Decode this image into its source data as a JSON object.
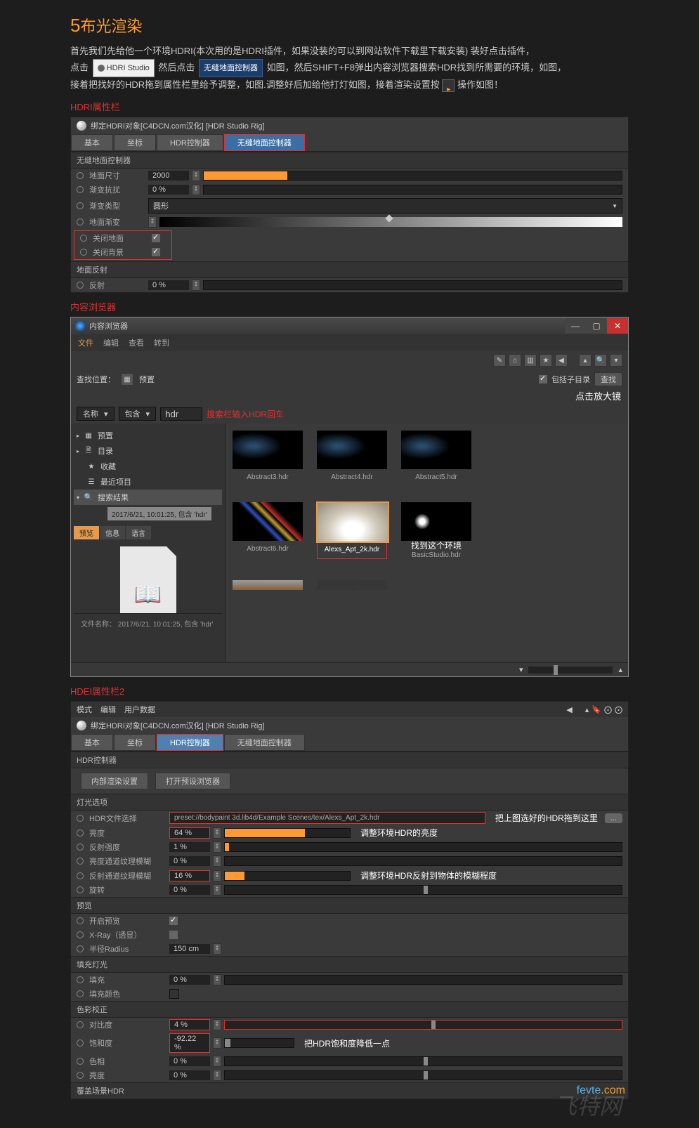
{
  "step": {
    "num": "5",
    "title": "布光渲染"
  },
  "intro": {
    "l1": "首先我们先给他一个环境HDRI(本次用的是HDRI插件，如果没装的可以到网站软件下载里下载安装) 装好点击插件，",
    "l2a": "点击",
    "hdri_btn": "HDRI Studio",
    "l2b": "然后点击",
    "ground_btn": "无缝地面控制器",
    "l2c": "如图，然后SHIFT+F8弹出内容浏览器搜索HDR找到所需要的环境，如图，",
    "l3a": "接着把找好的HDR拖到属性栏里给予调整，如图.调整好后加给他打灯如图，接着渲染设置按",
    "l3b": "操作如图！"
  },
  "sec1": "HDRI属性栏",
  "p1": {
    "head": "绑定HDRI对象[C4DCN.com汉化] [HDR Studio Rig]",
    "tabs": [
      "基本",
      "坐标",
      "HDR控制器",
      "无缝地面控制器"
    ],
    "sub1": "无缝地面控制器",
    "r1": {
      "lbl": "地面尺寸",
      "val": "2000"
    },
    "r2": {
      "lbl": "渐变抗扰",
      "val": "0 %"
    },
    "r3": {
      "lbl": "渐变类型",
      "val": "圆形"
    },
    "r4": {
      "lbl": "地面渐变"
    },
    "r5": {
      "lbl": "关闭地面"
    },
    "r6": {
      "lbl": "关闭背景"
    },
    "sub2": "地面反射",
    "r7": {
      "lbl": "反射",
      "val": "0 %"
    }
  },
  "sec2": "内容浏览器",
  "cb": {
    "title": "内容浏览器",
    "menu": [
      "文件",
      "编辑",
      "查看",
      "转到"
    ],
    "searchloc": "查找位置：",
    "preset": "预置",
    "include": "包括子目录",
    "searchbtn": "查找",
    "magnify": "点击放大镜",
    "name": "名称",
    "contain": "包含",
    "hdr": "hdr",
    "hint": "搜索栏输入HDR回车",
    "tree": [
      "预置",
      "目录",
      "收藏",
      "最近项目",
      "搜索结果"
    ],
    "tree_sub": "2017/6/21, 10:01:25, 包含 'hdr'",
    "ttabs": [
      "预览",
      "信息",
      "语言"
    ],
    "status": "文件名称：  2017/6/21, 10:01:25, 包含 'hdr'",
    "thumbs1": [
      "Abstract3.hdr",
      "Abstract4.hdr",
      "Abstract5.hdr"
    ],
    "thumbs2": [
      "Abstract6.hdr",
      "Alexs_Apt_2k.hdr",
      "BasicStudio.hdr"
    ],
    "found": "找到这个环境"
  },
  "sec3": "HDEI属性栏2",
  "p3": {
    "modes": [
      "模式",
      "编辑",
      "用户数据"
    ],
    "head": "绑定HDRI对象[C4DCN.com汉化] [HDR Studio Rig]",
    "tabs": [
      "基本",
      "坐标",
      "HDR控制器",
      "无缝地面控制器"
    ],
    "sub1": "HDR控制器",
    "btn1": "内部渲染设置",
    "btn2": "打开预设浏览器",
    "sub2": "灯光选项",
    "path_lbl": "HDR文件选择",
    "path": "preset://bodypaint 3d.lib4d/Example Scenes/tex/Alexs_Apt_2k.hdr",
    "ann_path": "把上图选好的HDR拖到这里",
    "bright": {
      "lbl": "亮度",
      "val": "64 %"
    },
    "ann_bright": "调整环境HDR的亮度",
    "refstr": {
      "lbl": "反射强度",
      "val": "1 %"
    },
    "brblur": {
      "lbl": "亮度通道纹理模糊",
      "val": "0 %"
    },
    "refblur": {
      "lbl": "反射通道纹理模糊",
      "val": "16 %"
    },
    "ann_refblur": "调整环境HDR反射到物体的模糊程度",
    "rot": {
      "lbl": "旋转",
      "val": "0 %"
    },
    "sub3": "预览",
    "prev": {
      "lbl": "开启预览"
    },
    "xray": {
      "lbl": "X-Ray（透显）"
    },
    "radius": {
      "lbl": "半径Radius",
      "val": "150 cm"
    },
    "sub4": "填充灯光",
    "fill": {
      "lbl": "填充",
      "val": "0 %"
    },
    "fillc": {
      "lbl": "填充颜色"
    },
    "sub5": "色彩校正",
    "contrast": {
      "lbl": "对比度",
      "val": "4 %"
    },
    "sat": {
      "lbl": "饱和度",
      "val": "-92.22 %"
    },
    "ann_sat": "把HDR饱和度降低一点",
    "hue": {
      "lbl": "色相",
      "val": "0 %"
    },
    "br2": {
      "lbl": "亮度",
      "val": "0 %"
    },
    "sub6": "覆盖场景HDR"
  },
  "wm": "fevte.com",
  "wm2": "飞特网"
}
